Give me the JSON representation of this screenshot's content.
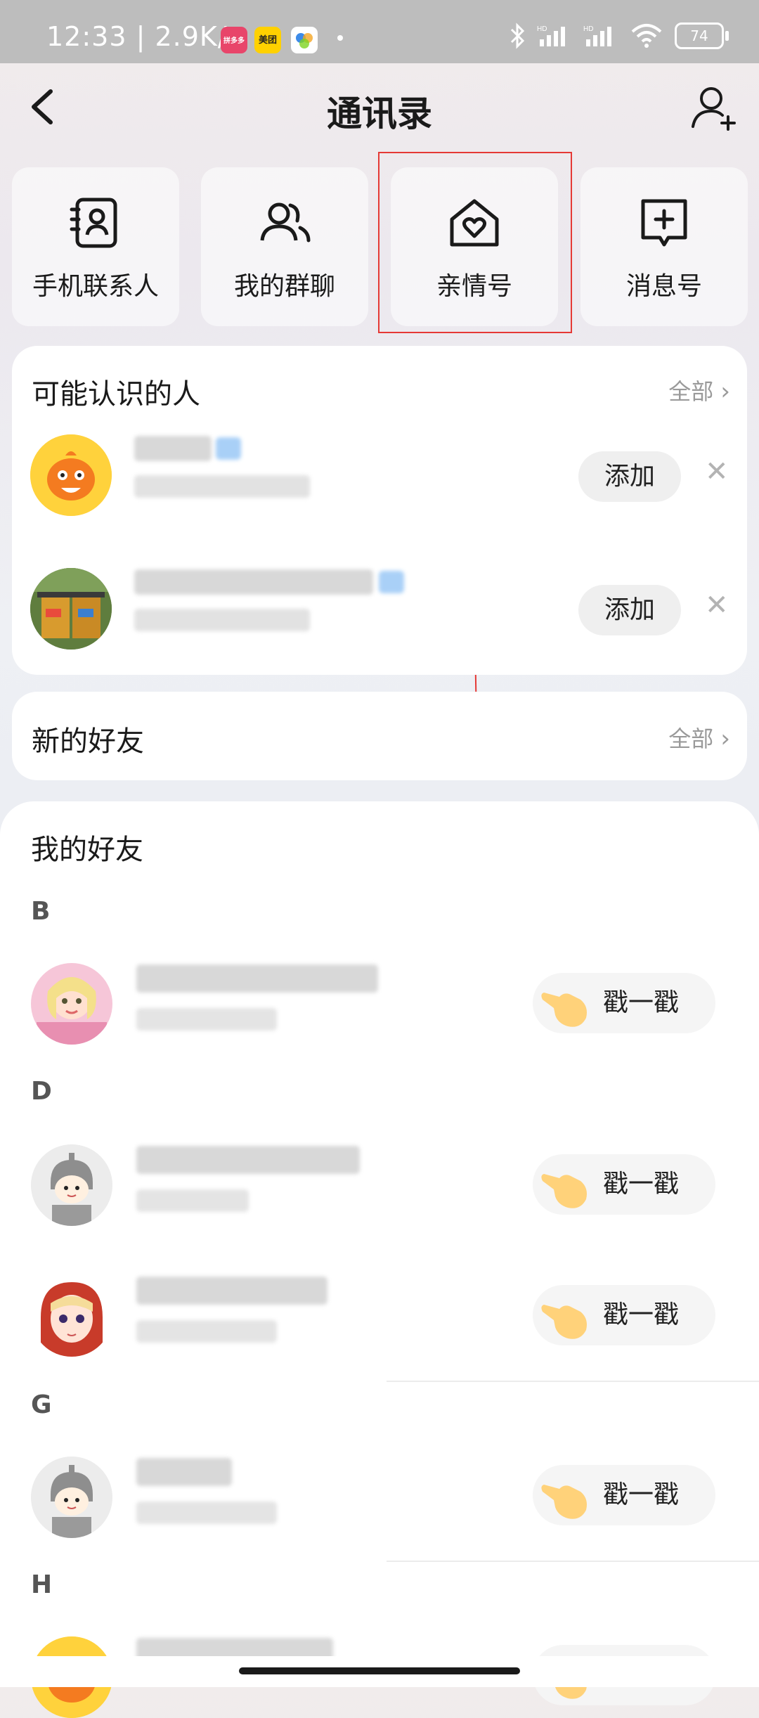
{
  "status_bar": {
    "time": "12:33",
    "speed": "2.9K/s",
    "app1": "拼多多",
    "app2": "美团",
    "battery": "74"
  },
  "header": {
    "title": "通讯录"
  },
  "quick_tiles": [
    {
      "label": "手机联系人",
      "icon": "contacts-book-icon"
    },
    {
      "label": "我的群聊",
      "icon": "group-icon"
    },
    {
      "label": "亲情号",
      "icon": "family-home-icon"
    },
    {
      "label": "消息号",
      "icon": "message-plus-icon"
    }
  ],
  "suggestions": {
    "title": "可能认识的人",
    "all_label": "全部",
    "add_label": "添加"
  },
  "new_friends": {
    "title": "新的好友",
    "all_label": "全部"
  },
  "friends": {
    "title": "我的好友",
    "poke_label": "戳一戳",
    "letters": [
      "B",
      "D",
      "G",
      "H"
    ]
  },
  "colors": {
    "highlight": "#e53935",
    "background": "#ffffff",
    "tile": "#f4f1f3"
  }
}
